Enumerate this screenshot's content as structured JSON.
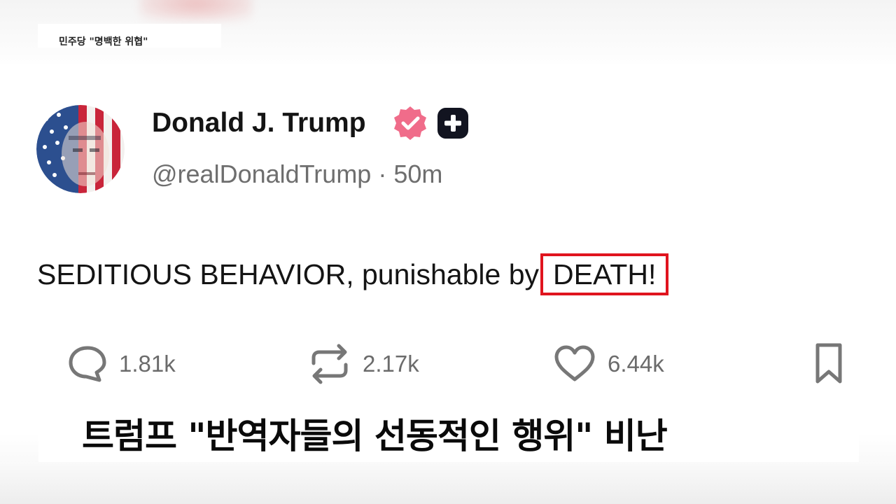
{
  "top_caption": "민주당 \"명백한 위협\"",
  "post": {
    "display_name": "Donald J. Trump",
    "handle": "@realDonaldTrump",
    "separator": "·",
    "time_ago": "50m",
    "text_before": "SEDITIOUS BEHAVIOR, punishable by",
    "text_highlight": "DEATH!",
    "reply_count": "1.81k",
    "repost_count": "2.17k",
    "like_count": "6.44k"
  },
  "icons": {
    "verified": "verified-badge-icon",
    "plus": "plus-badge-icon",
    "reply": "comment-icon",
    "repost": "repost-icon",
    "like": "heart-icon",
    "bookmark": "bookmark-icon"
  },
  "colors": {
    "verified_badge": "#f06c8a",
    "highlight_box": "#e0141e",
    "muted_text": "#6e6e6e"
  },
  "subtitle": "트럼프 \"반역자들의 선동적인 행위\" 비난"
}
